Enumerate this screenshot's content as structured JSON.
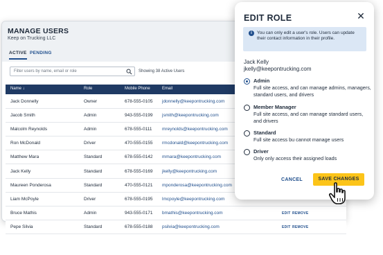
{
  "manage_users": {
    "title": "MANAGE USERS",
    "company": "Keep on Trucking LLC",
    "tabs": [
      {
        "label": "ACTIVE"
      },
      {
        "label": "PENDING"
      }
    ],
    "search_placeholder": "Filter users by name, email or role",
    "showing": "Showing 38 Active Users",
    "columns": [
      "Name ↓",
      "Role",
      "Mobile Phone",
      "Email"
    ],
    "rows": [
      {
        "name": "Jack Donnelly",
        "role": "Owner",
        "phone": "678-555-0105",
        "email": "jdonnelly@keepontrucking.com"
      },
      {
        "name": "Jacob Smith",
        "role": "Admin",
        "phone": "943-555-0199",
        "email": "jsmith@keepontrucking.com"
      },
      {
        "name": "Malcolm Reynolds",
        "role": "Admin",
        "phone": "678-555-0111",
        "email": "mreynolds@keepontrucking.com"
      },
      {
        "name": "Ron McDonald",
        "role": "Driver",
        "phone": "470-555-0155",
        "email": "rmcdonald@keepontrucking.com"
      },
      {
        "name": "Matthew Mara",
        "role": "Standard",
        "phone": "678-555-0142",
        "email": "mmara@keepontrucking.com"
      },
      {
        "name": "Jack Kelly",
        "role": "Standard",
        "phone": "678-555-0169",
        "email": "jkelly@keepontrucking.com"
      },
      {
        "name": "Maureen Ponderosa",
        "role": "Standard",
        "phone": "470-555-0121",
        "email": "mponderosa@keepontrucking.com"
      },
      {
        "name": "Liam McPoyle",
        "role": "Driver",
        "phone": "678-555-0195",
        "email": "lmcpoyle@keepontrucking.com"
      },
      {
        "name": "Bruce Mathis",
        "role": "Admin",
        "phone": "943-555-0171",
        "email": "bmathis@keepontrucking.com",
        "actions": [
          "EDIT",
          "REMOVE"
        ]
      },
      {
        "name": "Pepe Silvia",
        "role": "Standard",
        "phone": "678-555-0188",
        "email": "psilvia@keepontrucking.com",
        "actions": [
          "EDIT",
          "REMOVE"
        ]
      }
    ]
  },
  "edit_role": {
    "title": "EDIT ROLE",
    "close": "✕",
    "info_icon": "i",
    "info": "You can only edit a user's role. Users can update their contact information in their profile.",
    "user_name": "Jack Kelly",
    "user_email": "jkelly@keepontrucking.com",
    "options": [
      {
        "title": "Admin",
        "desc": "Full site access, and can manage admins, managers, standard users, and drivers",
        "selected": true
      },
      {
        "title": "Member Manager",
        "desc": "Full site access, and can manage standard users, and drivers",
        "selected": false
      },
      {
        "title": "Standard",
        "desc": "Full site access bu cannot manage users",
        "selected": false
      },
      {
        "title": "Driver",
        "desc": "Only only access their assigned loads",
        "selected": false
      }
    ],
    "cancel_label": "CANCEL",
    "save_label": "SAVE CHANGES"
  },
  "colors": {
    "brand_navy": "#1f3a64",
    "accent_blue": "#1f4e8c",
    "save_yellow": "#fcc419",
    "info_bg": "#dbe7f5"
  },
  "icons": [
    "search-icon",
    "close-icon",
    "info-icon",
    "sort-arrow-icon",
    "hand-pointer-icon"
  ]
}
